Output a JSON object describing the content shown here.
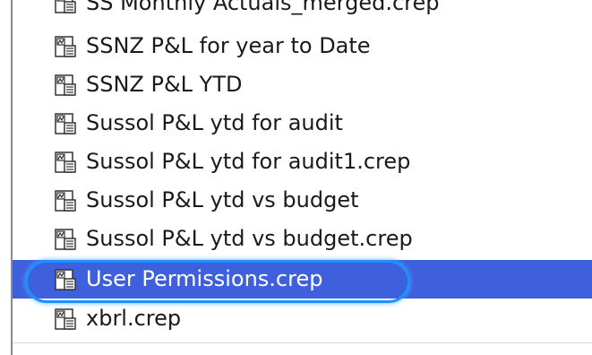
{
  "file_list": {
    "items": [
      {
        "label": "SS Monthly Actuals_merged.crep",
        "icon": "report-file-icon",
        "selected": false
      },
      {
        "label": "SSNZ P&L for year to Date",
        "icon": "report-file-icon",
        "selected": false
      },
      {
        "label": "SSNZ P&L YTD",
        "icon": "report-file-icon",
        "selected": false
      },
      {
        "label": "Sussol P&L ytd for audit",
        "icon": "report-file-icon",
        "selected": false
      },
      {
        "label": "Sussol P&L ytd for audit1.crep",
        "icon": "report-file-icon",
        "selected": false
      },
      {
        "label": "Sussol P&L ytd vs budget",
        "icon": "report-file-icon",
        "selected": false
      },
      {
        "label": "Sussol P&L ytd vs budget.crep",
        "icon": "report-file-icon",
        "selected": false
      },
      {
        "label": "User Permissions.crep",
        "icon": "report-file-icon",
        "selected": true
      },
      {
        "label": "xbrl.crep",
        "icon": "report-file-icon",
        "selected": false
      }
    ],
    "selection_color": "#3f60dc",
    "highlight_ring_color": "#1e90ff"
  }
}
